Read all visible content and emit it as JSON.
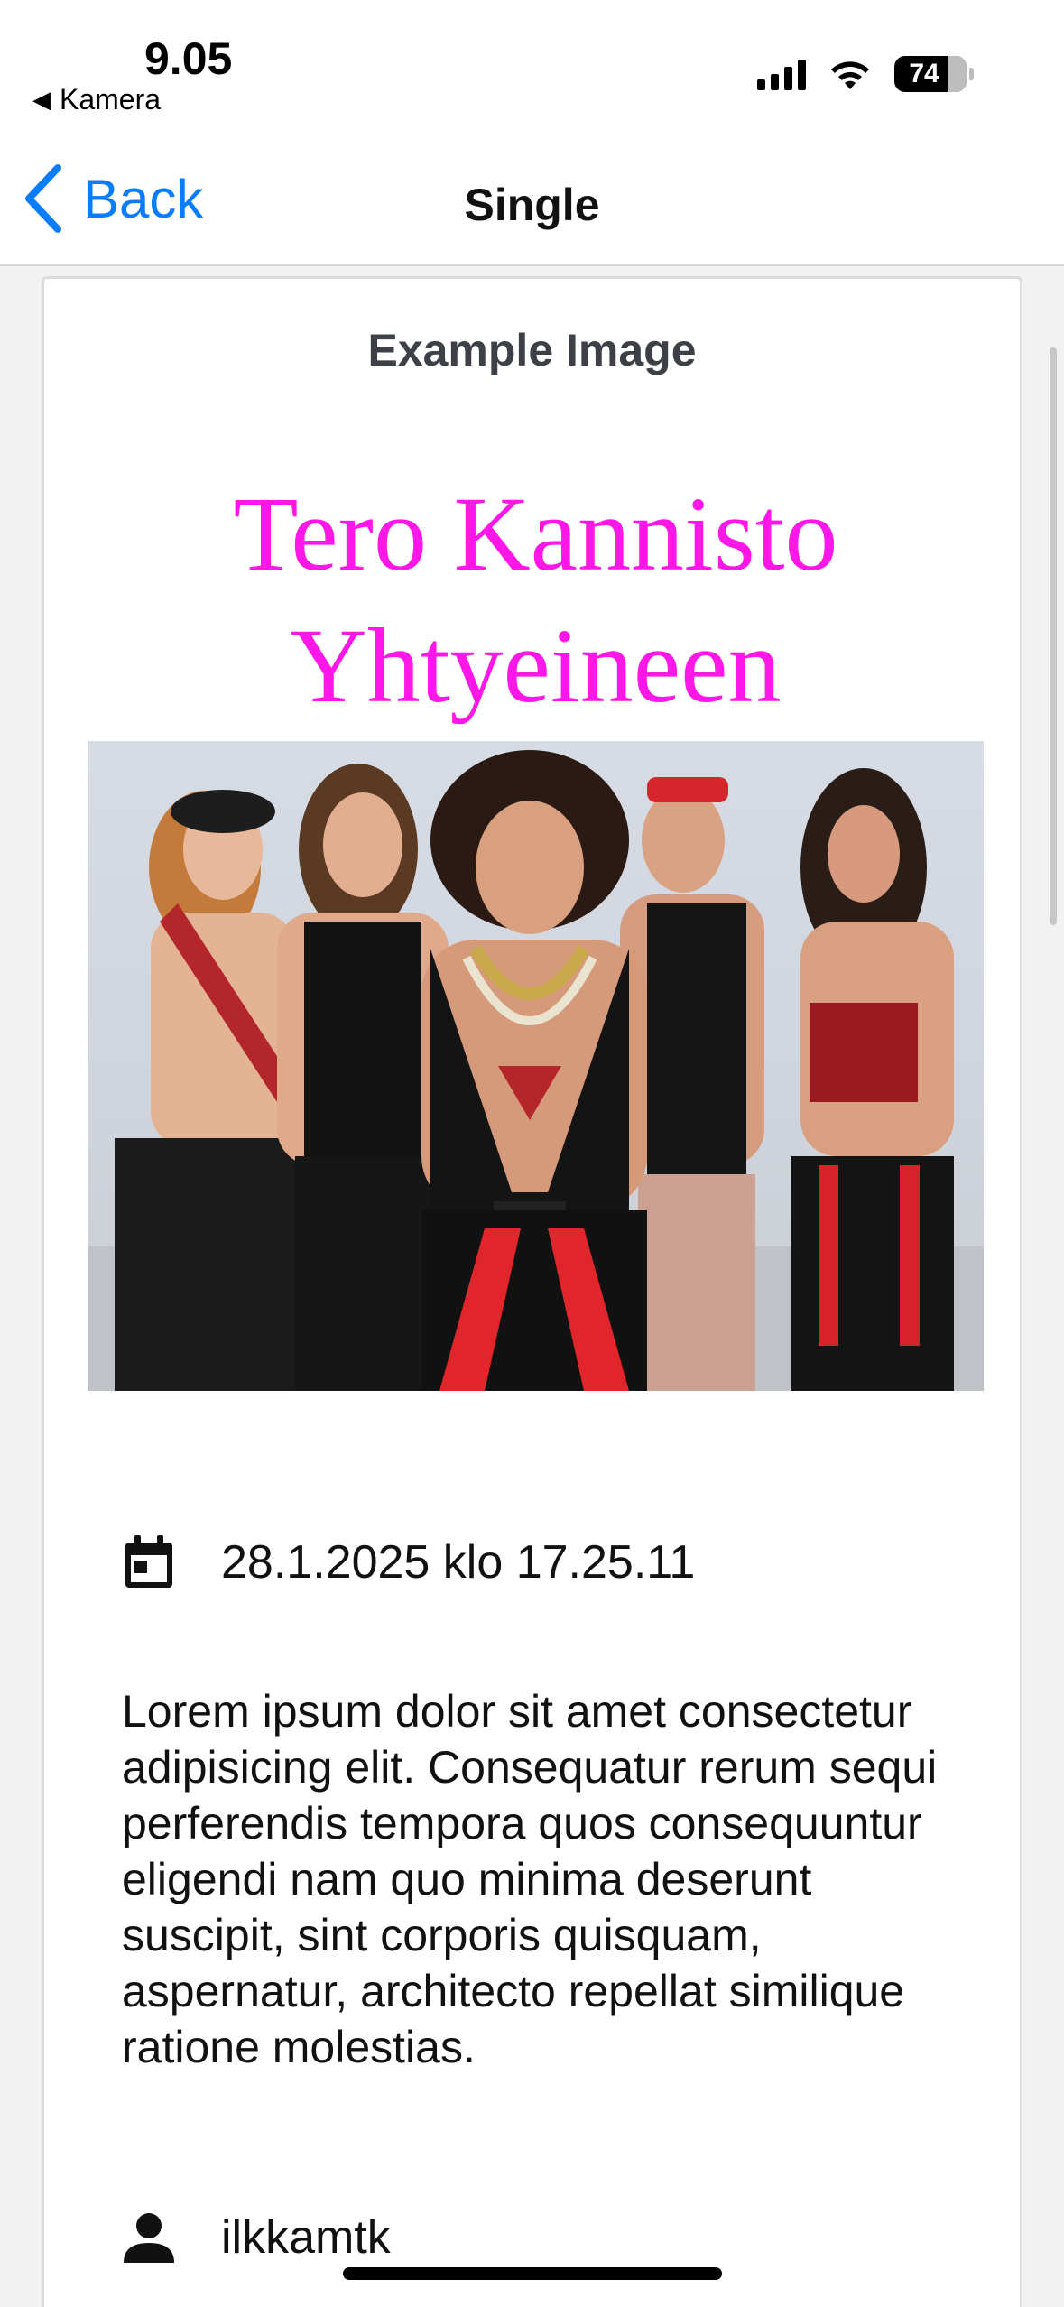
{
  "status_bar": {
    "time": "9.05",
    "back_app": "Kamera",
    "battery": "74"
  },
  "nav": {
    "back_label": "Back",
    "title": "Single"
  },
  "post": {
    "title": "Example Image",
    "poster_line1": "Tero Kannisto",
    "poster_line2": "Yhtyeineen",
    "date": "28.1.2025 klo 17.25.11",
    "description": "Lorem ipsum dolor sit amet consectetur adipisicing elit. Consequatur rerum sequi perferendis tempora quos consequuntur eligendi nam quo minima deserunt suscipit, sint corporis quisquam, aspernatur, architecto repellat similique ratione molestias.",
    "username": "ilkkamtk"
  },
  "icons": {
    "date": "calendar-icon",
    "user": "person-icon",
    "back": "chevron-left-icon"
  },
  "colors": {
    "accent": "#0a7cff",
    "poster_text": "#ff17e8",
    "title_text": "#3d4147"
  }
}
